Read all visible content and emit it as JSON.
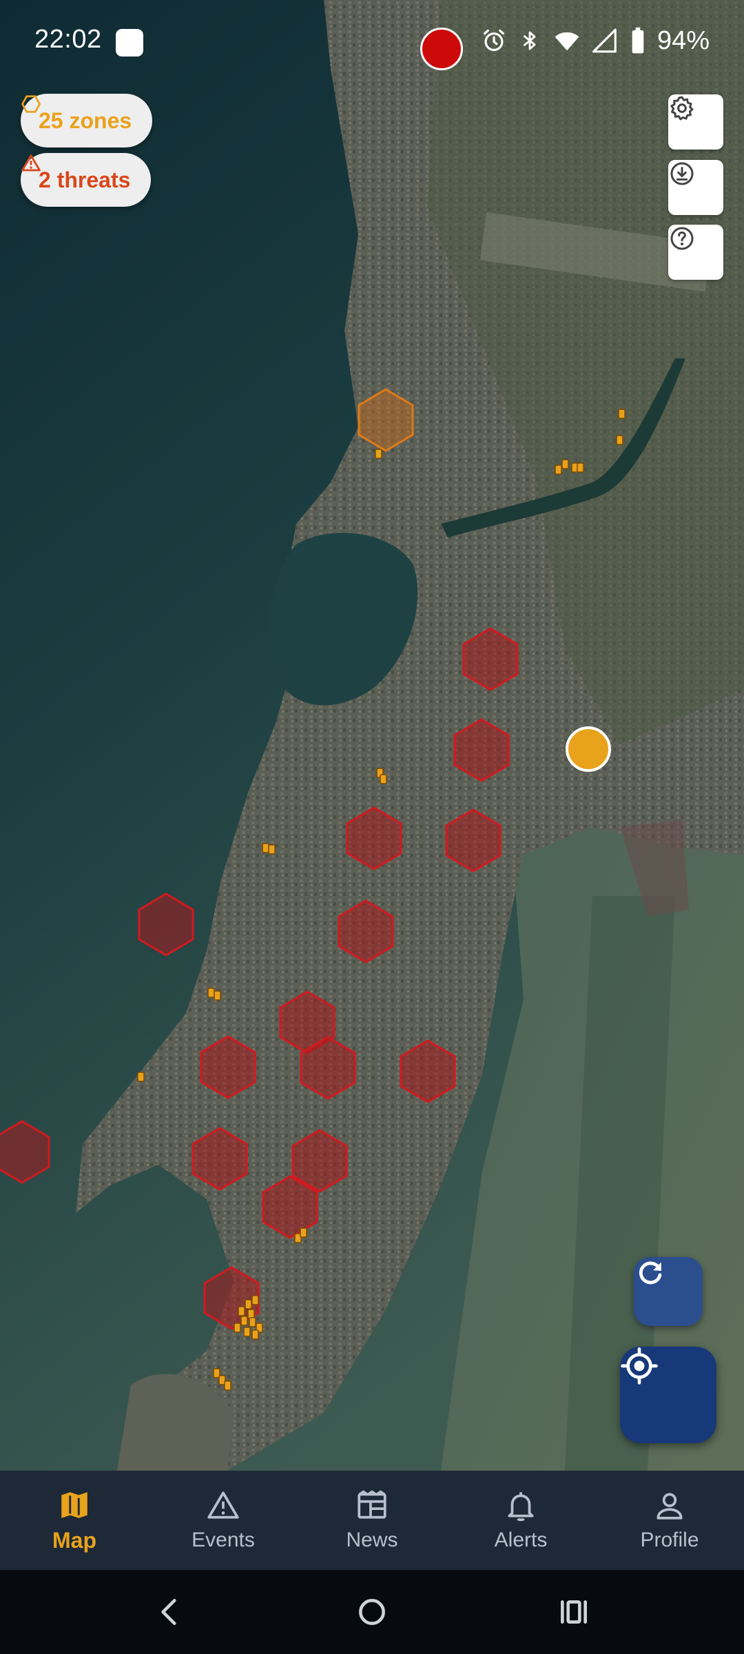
{
  "status_bar": {
    "time": "22:02",
    "battery": "94%"
  },
  "chips": {
    "zones": {
      "label": "25 zones",
      "icon": "hexagon-outline-icon",
      "color": "#e9a21c"
    },
    "threats": {
      "label": "2 threats",
      "icon": "warning-triangle-icon",
      "color": "#d9471b"
    }
  },
  "map_controls": {
    "settings_icon": "gear-icon",
    "download_icon": "download-circle-icon",
    "help_icon": "help-circle-icon",
    "refresh_icon": "refresh-icon",
    "locate_icon": "my-location-icon"
  },
  "map": {
    "zone_colors": {
      "danger": "#c4161c",
      "warning": "#e07b14",
      "user_location": "#e9a21c"
    }
  },
  "nav": {
    "items": [
      {
        "label": "Map",
        "icon": "map-icon",
        "active": true
      },
      {
        "label": "Events",
        "icon": "warning-icon",
        "active": false
      },
      {
        "label": "News",
        "icon": "newspaper-icon",
        "active": false
      },
      {
        "label": "Alerts",
        "icon": "bell-icon",
        "active": false
      },
      {
        "label": "Profile",
        "icon": "person-icon",
        "active": false
      }
    ],
    "active_color": "#e9a21c"
  }
}
